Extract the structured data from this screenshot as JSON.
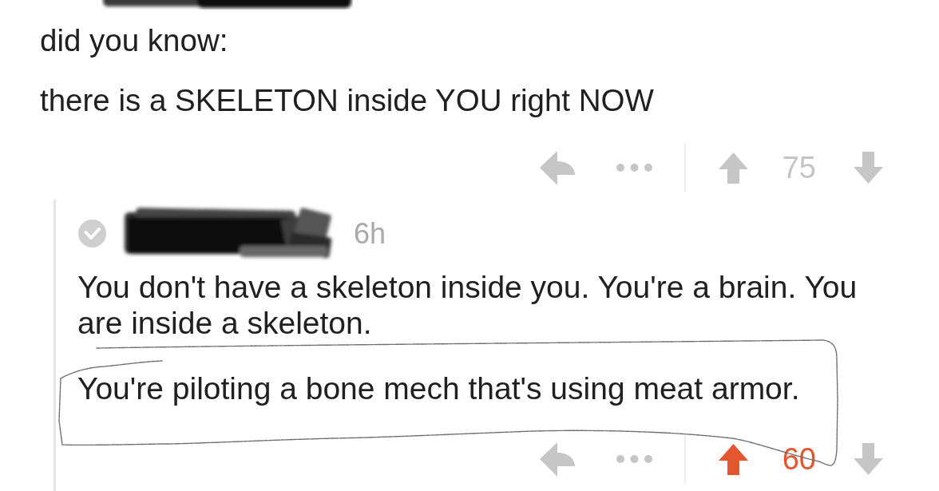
{
  "post": {
    "author": {
      "redacted": true
    },
    "paragraphs": [
      "did you know:",
      "there is a SKELETON inside YOU right NOW"
    ],
    "actions": {
      "score": "75",
      "upvoted": false
    }
  },
  "reply": {
    "author": {
      "redacted": true,
      "verified": true
    },
    "time": "6h",
    "paragraphs": [
      {
        "text": "You don't have a skeleton inside you. You're a brain. You are inside a skeleton.",
        "circled": false
      },
      {
        "text": "You're piloting a bone mech that's using meat armor.",
        "circled": true
      }
    ],
    "actions": {
      "score": "60",
      "upvoted": true
    }
  }
}
